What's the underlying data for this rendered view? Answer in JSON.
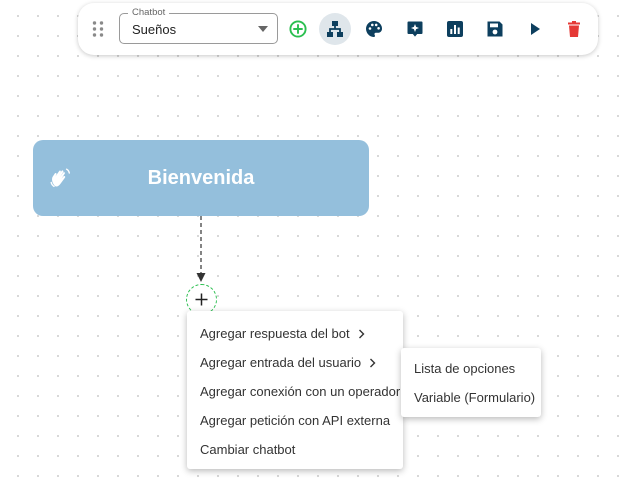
{
  "toolbar": {
    "chatbot_select": {
      "label": "Chatbot",
      "value": "Sueños"
    },
    "icons": [
      "drag-handle-icon",
      "add-circle-icon",
      "sitemap-icon",
      "palette-icon",
      "magic-chat-icon",
      "chart-icon",
      "save-icon",
      "play-icon",
      "trash-icon"
    ],
    "colors": {
      "accent_green": "#2bbf50",
      "icon_dark": "#0d3f5e",
      "delete_red": "#e53935"
    }
  },
  "canvas": {
    "node": {
      "title": "Bienvenida",
      "icon": "waving-hand-icon",
      "color": "#94bfdc"
    }
  },
  "context_menu": {
    "items": [
      {
        "label": "Agregar respuesta del bot",
        "has_submenu": true
      },
      {
        "label": "Agregar entrada del usuario",
        "has_submenu": true
      },
      {
        "label": "Agregar conexión con un operador",
        "has_submenu": false
      },
      {
        "label": "Agregar petición con API externa",
        "has_submenu": false
      },
      {
        "label": "Cambiar chatbot",
        "has_submenu": false
      }
    ]
  },
  "submenu": {
    "items": [
      {
        "label": "Lista de opciones"
      },
      {
        "label": "Variable (Formulario)"
      }
    ]
  }
}
